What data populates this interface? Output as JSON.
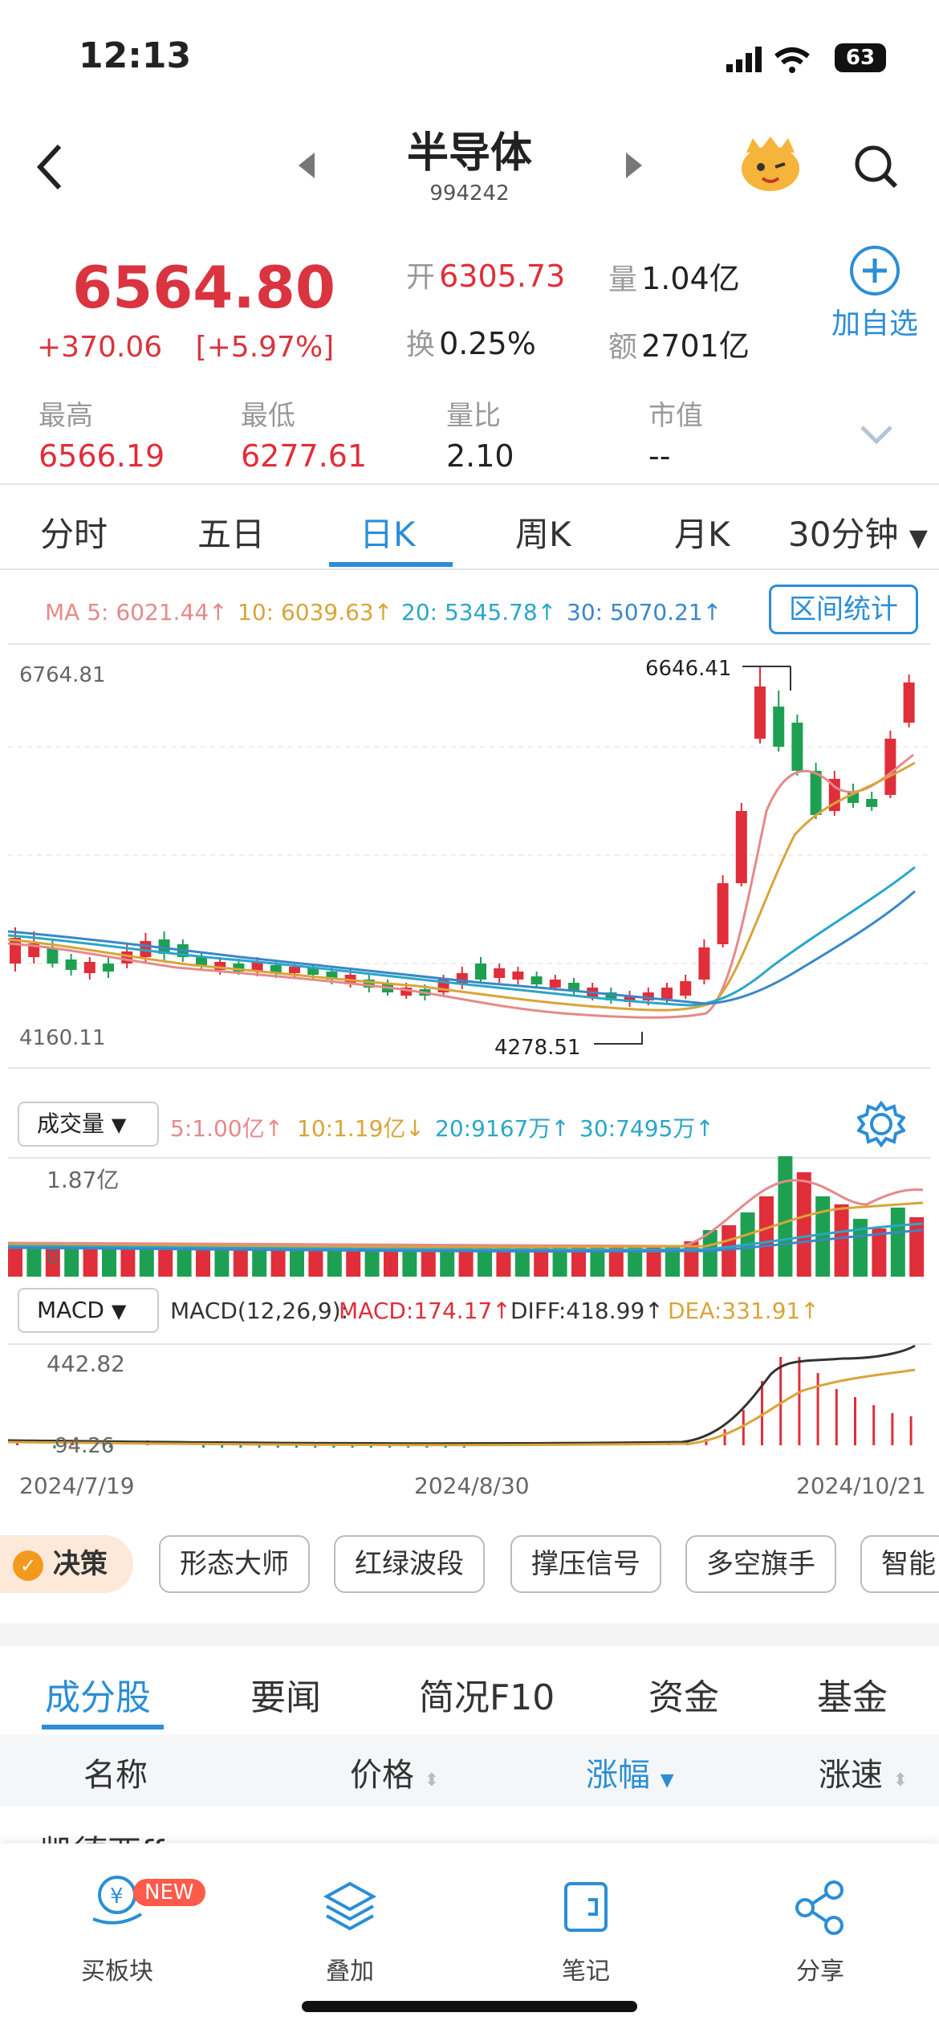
{
  "status": {
    "time": "12:13",
    "battery": "63"
  },
  "nav": {
    "title": "半导体",
    "code": "994242"
  },
  "quote": {
    "price": "6564.80",
    "change": "+370.06",
    "change_pct": "[+5.97%]",
    "open_label": "开",
    "open_value": "6305.73",
    "volume_label": "量",
    "volume_value": "1.04亿",
    "turnover_label": "换",
    "turnover_value": "0.25%",
    "amount_label": "额",
    "amount_value": "2701亿",
    "add_label": "加自选",
    "high_label": "最高",
    "high_value": "6566.19",
    "low_label": "最低",
    "low_value": "6277.61",
    "ratio_label": "量比",
    "ratio_value": "2.10",
    "mktcap_label": "市值",
    "mktcap_value": "--"
  },
  "period_tabs": [
    "分时",
    "五日",
    "日K",
    "周K",
    "月K",
    "30分钟"
  ],
  "active_period": "日K",
  "ma_legend": {
    "ma5": "MA 5: 6021.44↑",
    "ma10": "10: 6039.63↑",
    "ma20": "20: 5345.78↑",
    "ma30": "30: 5070.21↑",
    "range_btn": "区间统计"
  },
  "kline_labels": {
    "high_axis": "6764.81",
    "low_axis": "4160.11",
    "peak": "6646.41",
    "trough": "4278.51"
  },
  "volume": {
    "selector": "成交量",
    "ma5": "5:1.00亿↑",
    "ma10": "10:1.19亿↓",
    "ma20": "20:9167万↑",
    "ma30": "30:7495万↑",
    "axis_top": "1.87亿",
    "axis_zero": "0"
  },
  "macd": {
    "selector": "MACD",
    "params": "MACD(12,26,9):",
    "macd": "MACD:174.17↑",
    "diff": "DIFF:418.99↑",
    "dea": "DEA:331.91↑",
    "axis_top": "442.82",
    "axis_mid": "94.26"
  },
  "dates": [
    "2024/7/19",
    "2024/8/30",
    "2024/10/21"
  ],
  "features": {
    "decision": "决策",
    "buttons": [
      "形态大师",
      "红绿波段",
      "撑压信号",
      "多空旗手",
      "智能"
    ]
  },
  "sections": [
    "成分股",
    "要闻",
    "简况F10",
    "资金",
    "基金"
  ],
  "active_section": "成分股",
  "columns": [
    "名称",
    "价格",
    "涨幅",
    "涨速"
  ],
  "partial_row": "凯德西ff",
  "bottom_nav": [
    {
      "label": "买板块",
      "badge": "NEW"
    },
    {
      "label": "叠加"
    },
    {
      "label": "笔记"
    },
    {
      "label": "分享"
    }
  ],
  "colors": {
    "up": "#e02e3a",
    "down": "#1ea052",
    "accent": "#2b8ed6",
    "ma5": "#e58a8a",
    "ma10": "#d9a43a",
    "ma20": "#2aa6c8",
    "ma30": "#3a87c8"
  }
}
